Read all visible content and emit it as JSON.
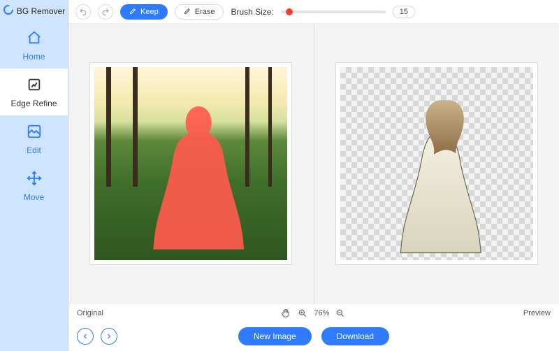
{
  "app": {
    "name": "BG Remover"
  },
  "sidebar": {
    "items": [
      {
        "label": "Home",
        "icon": "home-icon"
      },
      {
        "label": "Edge Refine",
        "icon": "edge-refine-icon"
      },
      {
        "label": "Edit",
        "icon": "edit-icon"
      },
      {
        "label": "Move",
        "icon": "move-icon"
      }
    ],
    "active_index": 1
  },
  "toolbar": {
    "keep_label": "Keep",
    "erase_label": "Erase",
    "brush_label": "Brush Size:",
    "brush_value": "15"
  },
  "panes": {
    "original_label": "Original",
    "preview_label": "Preview",
    "zoom_text": "76%"
  },
  "footer": {
    "new_image_label": "New Image",
    "download_label": "Download"
  },
  "colors": {
    "accent": "#2f7bff",
    "mask_overlay": "#ff5a4d",
    "slider_thumb": "#ff3b30"
  }
}
